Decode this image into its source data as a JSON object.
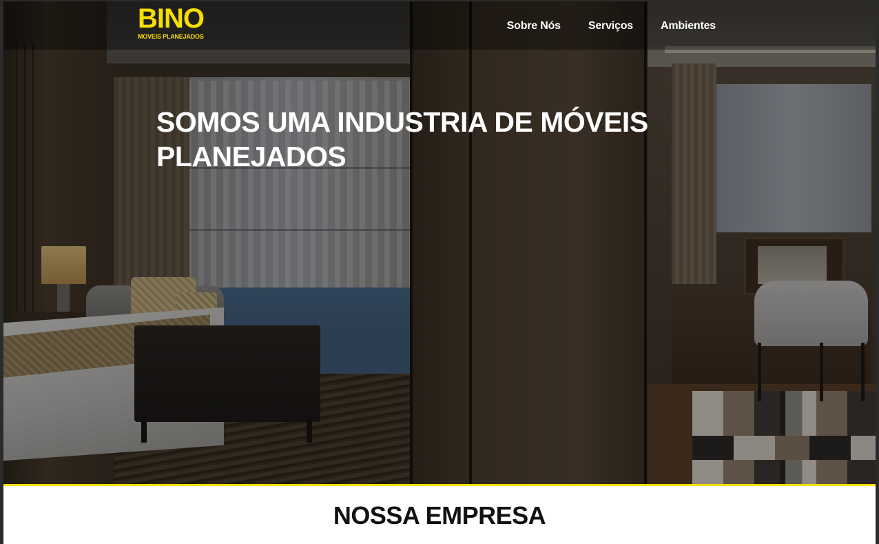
{
  "brand": {
    "name": "BINO",
    "tagline": "MOVEIS PLANEJADOS",
    "accent_color": "#f7df00"
  },
  "nav": {
    "items": [
      {
        "label": "Sobre Nós"
      },
      {
        "label": "Serviços"
      },
      {
        "label": "Ambientes"
      }
    ]
  },
  "hero": {
    "title": "SOMOS UMA INDUSTRIA DE MÓVEIS PLANEJADOS",
    "background": "bedroom-interior-photo"
  },
  "section": {
    "title": "NOSSA EMPRESA"
  }
}
